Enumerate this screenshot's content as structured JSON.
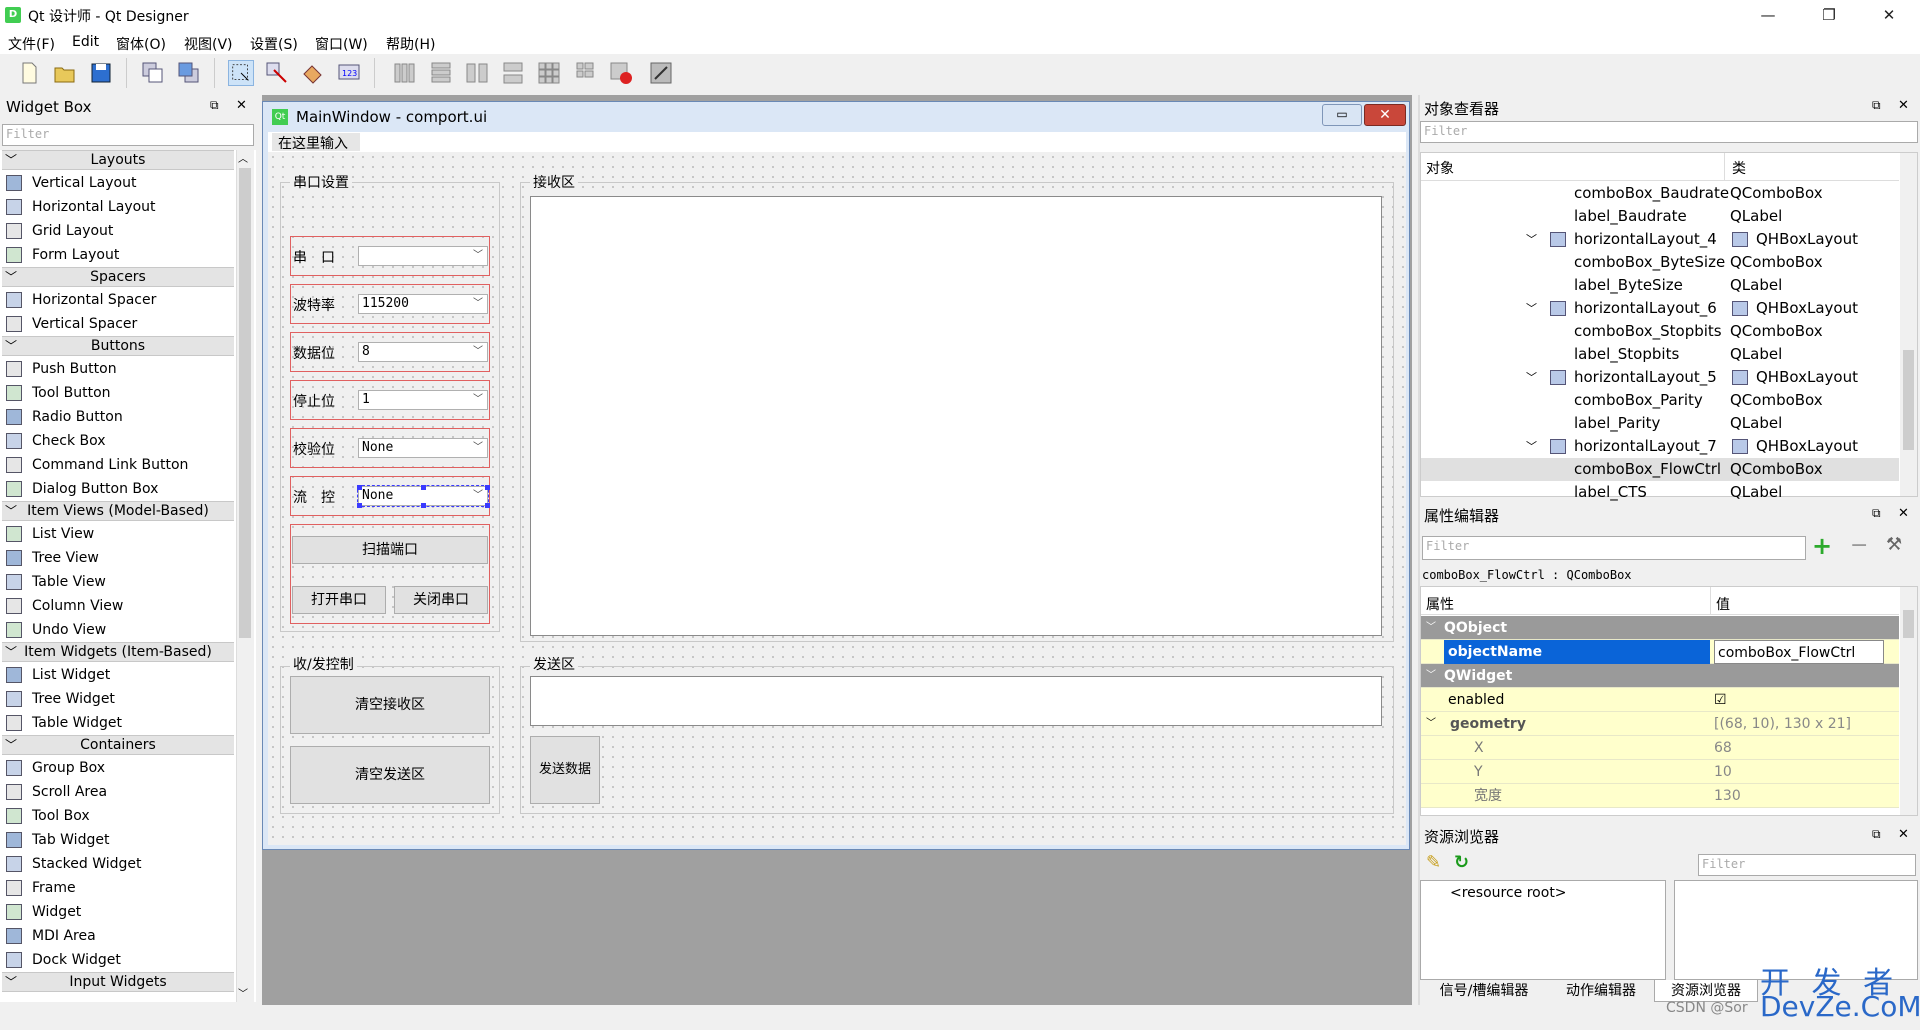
{
  "window": {
    "title": "Qt 设计师 - Qt Designer",
    "app_icon": "D",
    "min": "—",
    "max": "❐",
    "close": "✕"
  },
  "menu": [
    "文件(F)",
    "Edit",
    "窗体(O)",
    "视图(V)",
    "设置(S)",
    "窗口(W)",
    "帮助(H)"
  ],
  "widget_box": {
    "title": "Widget Box",
    "filter": "Filter",
    "sections": [
      {
        "name": "Layouts",
        "items": [
          "Vertical Layout",
          "Horizontal Layout",
          "Grid Layout",
          "Form Layout"
        ]
      },
      {
        "name": "Spacers",
        "items": [
          "Horizontal Spacer",
          "Vertical Spacer"
        ]
      },
      {
        "name": "Buttons",
        "items": [
          "Push Button",
          "Tool Button",
          "Radio Button",
          "Check Box",
          "Command Link Button",
          "Dialog Button Box"
        ]
      },
      {
        "name": "Item Views (Model-Based)",
        "items": [
          "List View",
          "Tree View",
          "Table View",
          "Column View",
          "Undo View"
        ]
      },
      {
        "name": "Item Widgets (Item-Based)",
        "items": [
          "List Widget",
          "Tree Widget",
          "Table Widget"
        ]
      },
      {
        "name": "Containers",
        "items": [
          "Group Box",
          "Scroll Area",
          "Tool Box",
          "Tab Widget",
          "Stacked Widget",
          "Frame",
          "Widget",
          "MDI Area",
          "Dock Widget"
        ]
      },
      {
        "name": "Input Widgets",
        "items": []
      }
    ]
  },
  "form": {
    "caption": "MainWindow - comport.ui",
    "qt_badge": "Qt",
    "menu_placeholder": "在这里输入",
    "serial_group": "串口设置",
    "fields": [
      {
        "label": "串　口",
        "value": ""
      },
      {
        "label": "波特率",
        "value": "115200"
      },
      {
        "label": "数据位",
        "value": "8"
      },
      {
        "label": "停止位",
        "value": "1"
      },
      {
        "label": "校验位",
        "value": "None"
      },
      {
        "label": "流　控",
        "value": "None"
      }
    ],
    "scan_btn": "扫描端口",
    "open_btn": "打开串口",
    "close_btn": "关闭串口",
    "recv_group": "接收区",
    "ctrl_group": "收/发控制",
    "clear_recv": "清空接收区",
    "clear_send": "清空发送区",
    "send_group": "发送区",
    "send_btn": "发送数据"
  },
  "object_inspector": {
    "title": "对象查看器",
    "filter": "Filter",
    "col_object": "对象",
    "col_class": "类",
    "rows": [
      {
        "obj": "comboBox_Baudrate",
        "cls": "QComboBox",
        "indent": 2,
        "layout": false
      },
      {
        "obj": "label_Baudrate",
        "cls": "QLabel",
        "indent": 2,
        "layout": false
      },
      {
        "obj": "horizontalLayout_4",
        "cls": "QHBoxLayout",
        "indent": 1,
        "layout": true
      },
      {
        "obj": "comboBox_ByteSize",
        "cls": "QComboBox",
        "indent": 2,
        "layout": false
      },
      {
        "obj": "label_ByteSize",
        "cls": "QLabel",
        "indent": 2,
        "layout": false
      },
      {
        "obj": "horizontalLayout_6",
        "cls": "QHBoxLayout",
        "indent": 1,
        "layout": true
      },
      {
        "obj": "comboBox_Stopbits",
        "cls": "QComboBox",
        "indent": 2,
        "layout": false
      },
      {
        "obj": "label_Stopbits",
        "cls": "QLabel",
        "indent": 2,
        "layout": false
      },
      {
        "obj": "horizontalLayout_5",
        "cls": "QHBoxLayout",
        "indent": 1,
        "layout": true
      },
      {
        "obj": "comboBox_Parity",
        "cls": "QComboBox",
        "indent": 2,
        "layout": false
      },
      {
        "obj": "label_Parity",
        "cls": "QLabel",
        "indent": 2,
        "layout": false
      },
      {
        "obj": "horizontalLayout_7",
        "cls": "QHBoxLayout",
        "indent": 1,
        "layout": true
      },
      {
        "obj": "comboBox_FlowCtrl",
        "cls": "QComboBox",
        "indent": 2,
        "layout": false,
        "selected": true
      },
      {
        "obj": "label_CTS",
        "cls": "QLabel",
        "indent": 2,
        "layout": false
      }
    ]
  },
  "property_editor": {
    "title": "属性编辑器",
    "filter": "Filter",
    "selected_obj": "comboBox_FlowCtrl : QComboBox",
    "col_prop": "属性",
    "col_val": "值",
    "rows": [
      {
        "type": "cat",
        "name": "QObject"
      },
      {
        "type": "sel",
        "name": "objectName",
        "value": "comboBox_FlowCtrl"
      },
      {
        "type": "cat",
        "name": "QWidget"
      },
      {
        "type": "prop",
        "name": "enabled",
        "value": "☑"
      },
      {
        "type": "group",
        "name": "geometry",
        "value": "[(68, 10), 130 x 21]"
      },
      {
        "type": "sub",
        "name": "X",
        "value": "68"
      },
      {
        "type": "sub",
        "name": "Y",
        "value": "10"
      },
      {
        "type": "sub",
        "name": "宽度",
        "value": "130"
      }
    ]
  },
  "resource_browser": {
    "title": "资源浏览器",
    "filter": "Filter",
    "root": "<resource root>",
    "tabs": [
      "信号/槽编辑器",
      "动作编辑器",
      "资源浏览器"
    ]
  },
  "watermark": {
    "line1": "开 发 者",
    "line2": "DevZe.CoM",
    "csdn": "CSDN @Sor"
  }
}
